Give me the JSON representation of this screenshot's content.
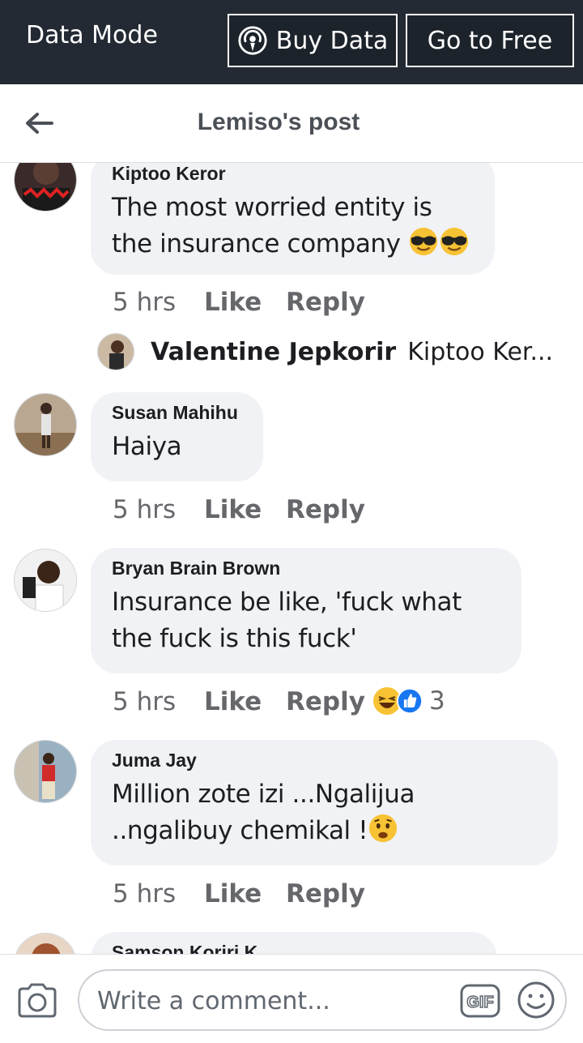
{
  "topbar": {
    "mode_label": "Data Mode",
    "buy_label": "Buy Data",
    "free_label": "Go to Free",
    "bg_color": "#232a33"
  },
  "header": {
    "title": "Lemiso's post",
    "back_icon": "arrow-left-icon"
  },
  "comments": [
    {
      "author": "Kiptoo Keror",
      "text": "The most worried entity is the insurance company",
      "emoji": [
        "sunglasses-emoji",
        "sunglasses-emoji"
      ],
      "time": "5 hrs",
      "like": "Like",
      "reply": "Reply",
      "reply_preview": {
        "author": "Valentine Jepkorir",
        "text": "Kiptoo Ker..."
      }
    },
    {
      "author": "Susan Mahihu",
      "text": "Haiya",
      "time": "5 hrs",
      "like": "Like",
      "reply": "Reply"
    },
    {
      "author": "Bryan Brain Brown",
      "text": "Insurance be like, 'fuck what the fuck is this fuck'",
      "time": "5 hrs",
      "like": "Like",
      "reply": "Reply",
      "reactions": {
        "icons": [
          "haha-icon",
          "like-icon"
        ],
        "count": "3"
      }
    },
    {
      "author": "Juma Jay",
      "text": "Million zote izi ...Ngalijua ..ngalibuy chemikal !",
      "emoji": [
        "worried-emoji"
      ],
      "time": "5 hrs",
      "like": "Like",
      "reply": "Reply"
    },
    {
      "author": "Samson Koriri K"
    }
  ],
  "composer": {
    "placeholder": "Write a comment...",
    "gif_label": "GIF"
  }
}
